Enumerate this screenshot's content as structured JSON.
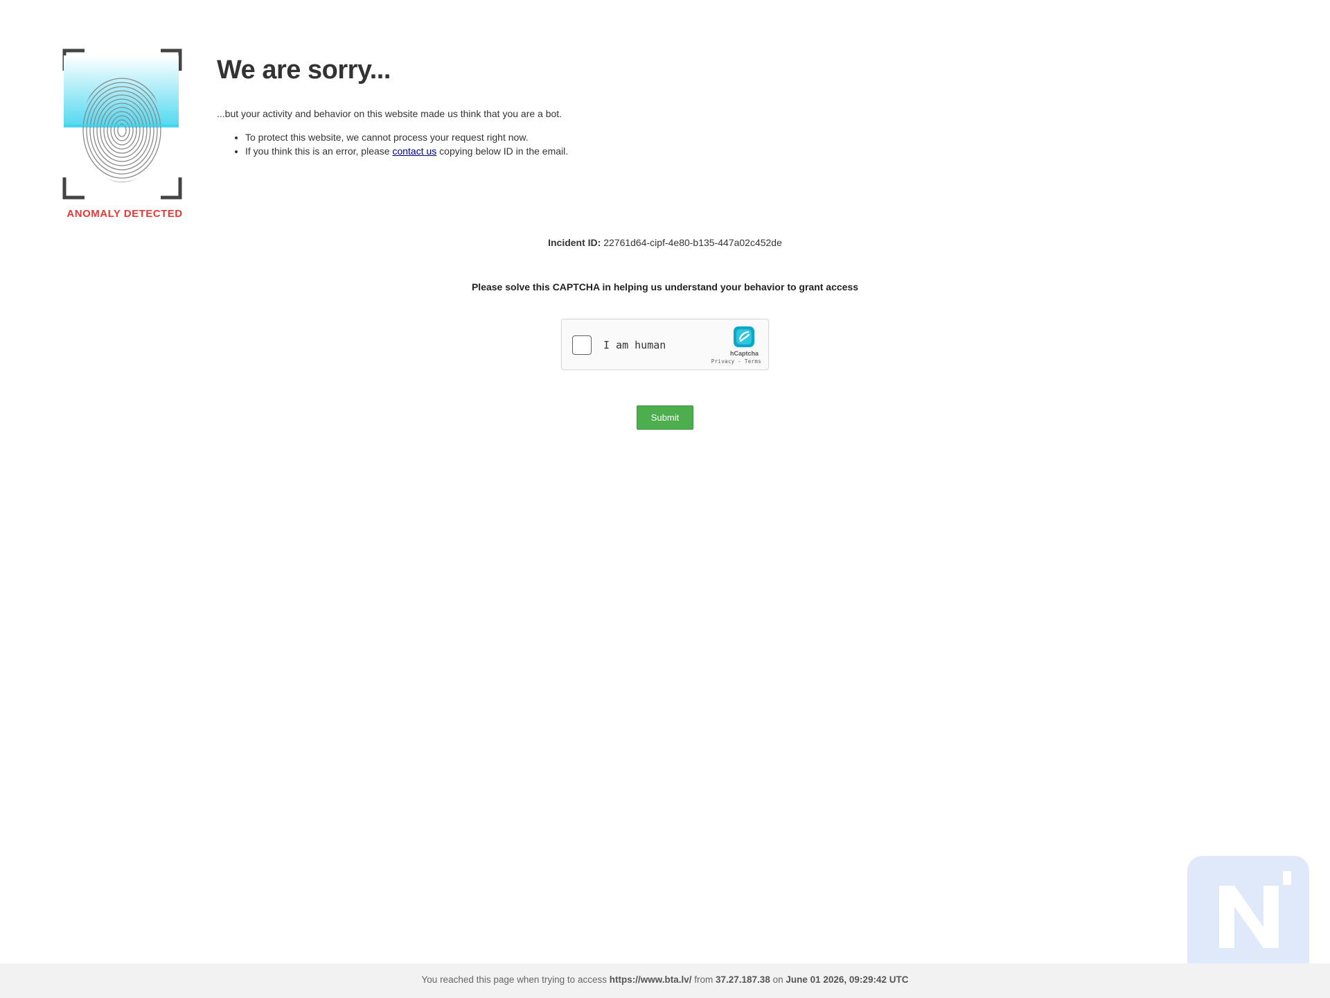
{
  "logo": {
    "caption": "ANOMALY DETECTED",
    "icon": "fingerprint-icon"
  },
  "heading": "We are sorry...",
  "intro": "...but your activity and behavior on this website made us think that you are a bot.",
  "reasons": {
    "item1": "To protect this website, we cannot process your request right now.",
    "item2_prefix": "If you think this is an error, please ",
    "item2_link": "contact us",
    "item2_suffix": " copying below ID in the email."
  },
  "incident": {
    "label": "Incident ID:",
    "id": "22761d64-cipf-4e80-b135-447a02c452de"
  },
  "captcha_prompt": "Please solve this CAPTCHA in helping us understand your behavior to grant access",
  "captcha": {
    "label": "I am human",
    "brand": "hCaptcha",
    "privacy": "Privacy",
    "separator": " - ",
    "terms": "Terms",
    "checked": false
  },
  "submit_label": "Submit",
  "footer": {
    "prefix": "You reached this page when trying to access ",
    "url": "https://www.bta.lv/",
    "from_text": " from ",
    "ip": "37.27.187.38",
    "on_text": " on ",
    "datetime": "June 01 2026, 09:29:42 UTC"
  },
  "colors": {
    "submit": "#4cae4c",
    "anomaly_red": "#e53935",
    "scan_cyan": "#4fd8f0",
    "link": "#000080",
    "footer_bg": "#f2f2f2"
  }
}
